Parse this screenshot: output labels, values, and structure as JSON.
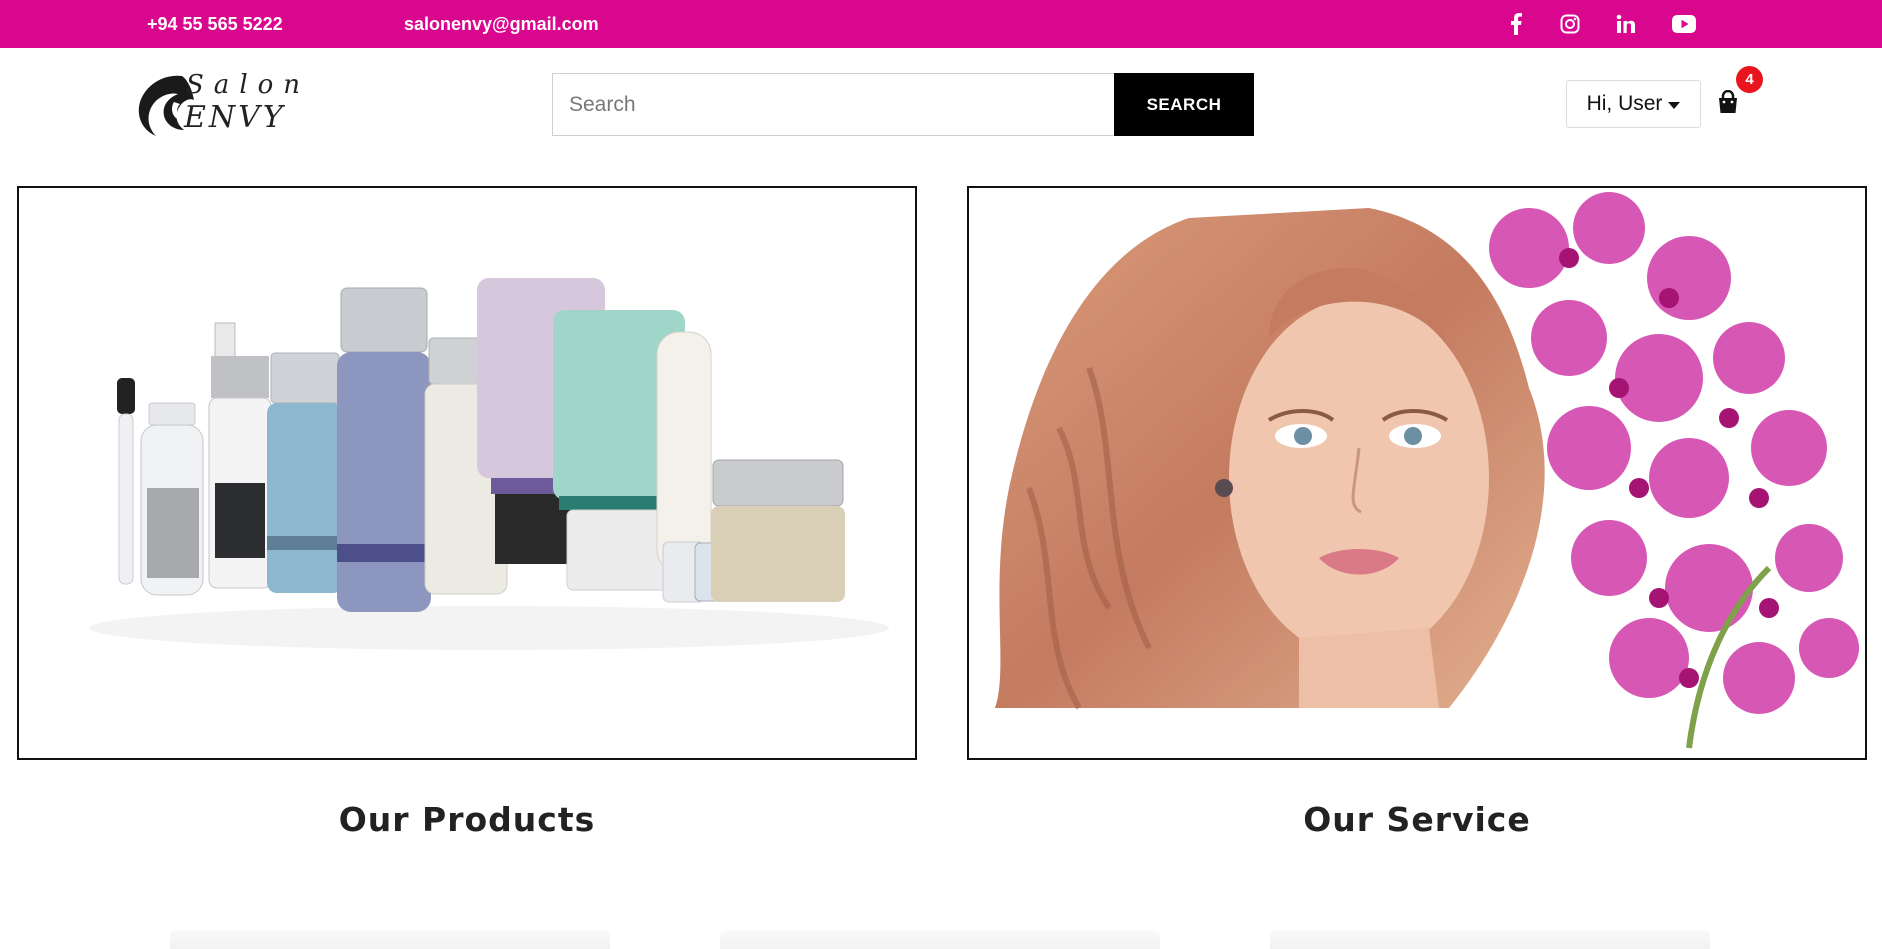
{
  "topbar": {
    "phone": "+94 55 565 5222",
    "email": "salonenvy@gmail.com",
    "social": [
      {
        "name": "facebook-icon"
      },
      {
        "name": "instagram-icon"
      },
      {
        "name": "linkedin-icon"
      },
      {
        "name": "youtube-icon"
      }
    ],
    "bg_color": "#d9078e"
  },
  "header": {
    "logo": {
      "line1": "Salon",
      "line2": "ENVY"
    },
    "search": {
      "placeholder": "Search",
      "value": "",
      "button_label": "SEARCH"
    },
    "user_menu": {
      "label": "Hi, User"
    },
    "cart": {
      "count": "4"
    }
  },
  "sections": [
    {
      "title": "Our Products",
      "image": "hair-product-bottles-photo"
    },
    {
      "title": "Our Service",
      "image": "woman-with-orchids-photo"
    }
  ]
}
